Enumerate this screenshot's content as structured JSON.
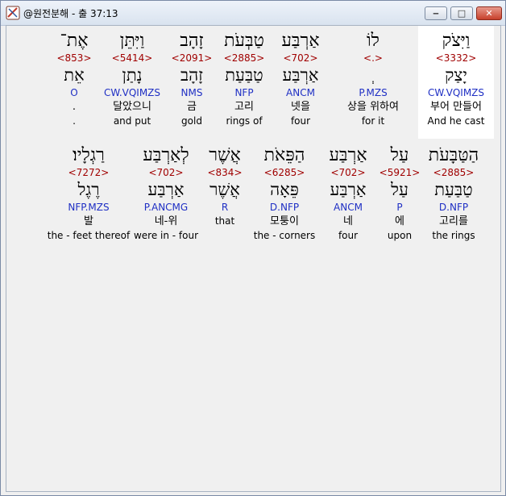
{
  "window": {
    "title": "@원전분해 - 출 37:13",
    "min_glyph": "‒",
    "max_glyph": "□",
    "close_glyph": "✕"
  },
  "rows": [
    {
      "words": [
        {
          "heb": "וַיִּצֹק",
          "strong": "<3332>",
          "lemma": "יָצַק",
          "morph": "CW.VQIMZS",
          "kor": "부어 만들어",
          "eng": "And he cast"
        },
        {
          "heb": "לוֹ",
          "strong": "<.>",
          "lemma": "ְ",
          "morph": "P.MZS",
          "kor": "상을 위하여",
          "eng": "for it"
        },
        {
          "heb": "אַרְבַּע",
          "strong": "<702>",
          "lemma": "אַרְבַּע",
          "morph": "ANCM",
          "kor": "넷을",
          "eng": "four"
        },
        {
          "heb": "טַבְּעֹת",
          "strong": "<2885>",
          "lemma": "טַבַּעַת",
          "morph": "NFP",
          "kor": "고리",
          "eng": "rings of"
        },
        {
          "heb": "זָהָב",
          "strong": "<2091>",
          "lemma": "זָהָב",
          "morph": "NMS",
          "kor": "금",
          "eng": "gold"
        },
        {
          "heb": "וַיִּתֵּן",
          "strong": "<5414>",
          "lemma": "נָתַן",
          "morph": "CW.VQIMZS",
          "kor": "달았으니",
          "eng": "and put"
        },
        {
          "heb": "אֶת־",
          "strong": "<853>",
          "lemma": "אֵת",
          "morph": "O",
          "kor": ".",
          "eng": "."
        }
      ]
    },
    {
      "words": [
        {
          "heb": "הַטַּבָּעֹת",
          "strong": "<2885>",
          "lemma": "טַבַּעַת",
          "morph": "D.NFP",
          "kor": "고리를",
          "eng": "the rings"
        },
        {
          "heb": "עַל",
          "strong": "<5921>",
          "lemma": "עַל",
          "morph": "P",
          "kor": "에",
          "eng": "upon"
        },
        {
          "heb": "אַרְבַּע",
          "strong": "<702>",
          "lemma": "אַרְבַּע",
          "morph": "ANCM",
          "kor": "네",
          "eng": "four"
        },
        {
          "heb": "הַפֵּאֹת",
          "strong": "<6285>",
          "lemma": "פֵּאָה",
          "morph": "D.NFP",
          "kor": "모퉁이",
          "eng": "the - corners"
        },
        {
          "heb": "אֲשֶׁר",
          "strong": "<834>",
          "lemma": "אֲשֶׁר",
          "morph": "R",
          "kor": "",
          "eng": "that"
        },
        {
          "heb": "לְאַרְבַּע",
          "strong": "<702>",
          "lemma": "אַרְבַּע",
          "morph": "P.ANCMG",
          "kor": "네-위",
          "eng": "were in - four"
        },
        {
          "heb": "רַגְלָיו׃",
          "strong": "<7272>",
          "lemma": "רֶגֶל",
          "morph": "NFP.MZS",
          "kor": "발",
          "eng": "the - feet thereof"
        }
      ]
    }
  ]
}
